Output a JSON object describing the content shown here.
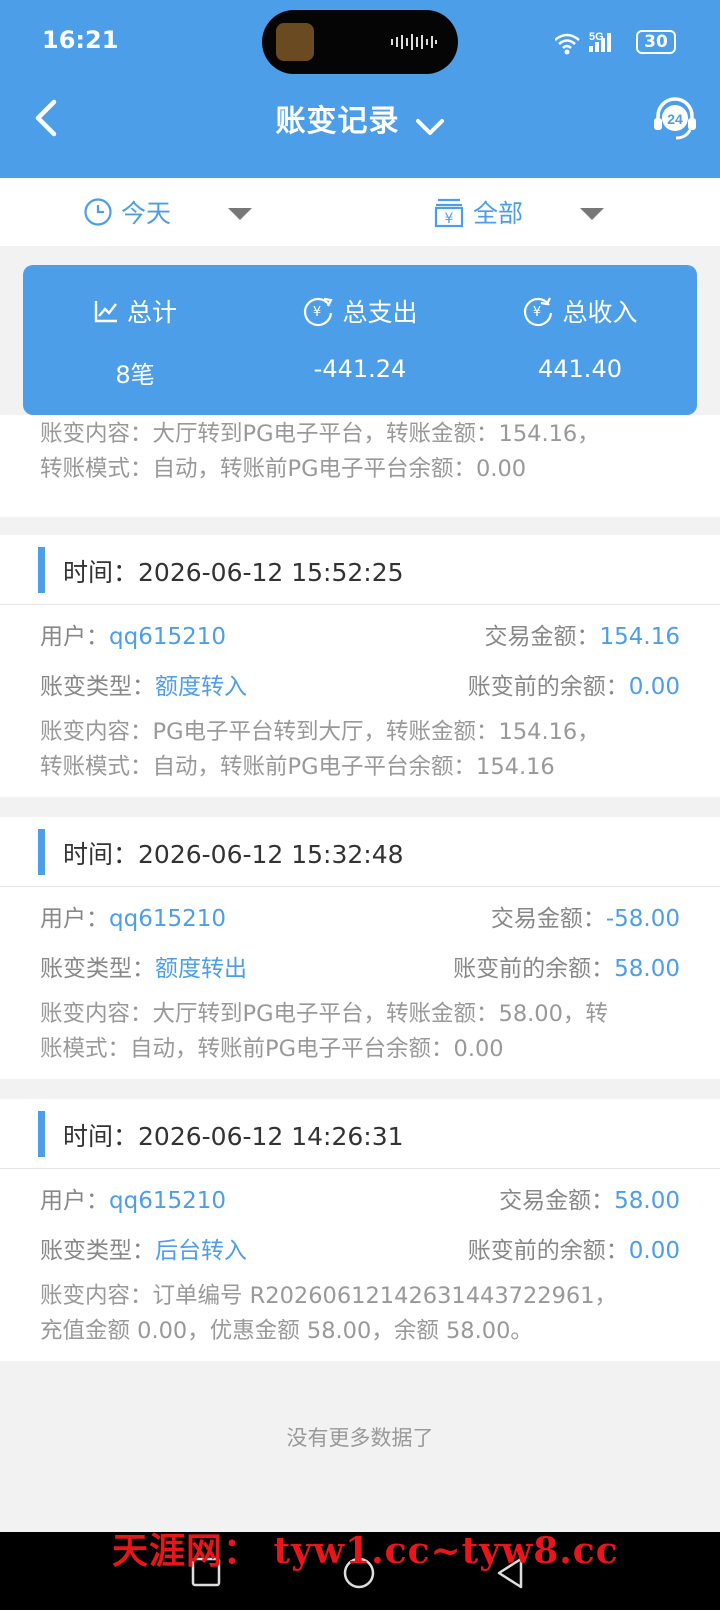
{
  "status_bar": {
    "time": "16:21",
    "network": "5G",
    "battery": "30"
  },
  "header": {
    "title": "账变记录",
    "back_icon": "chevron-left-icon",
    "support_icon": "headset-24-icon"
  },
  "filters": {
    "date": {
      "label": "今天",
      "icon": "clock-icon"
    },
    "type": {
      "label": "全部",
      "icon": "yen-box-icon"
    }
  },
  "summary": {
    "total": {
      "label": "总计",
      "value": "8笔"
    },
    "expense": {
      "label": "总支出",
      "value": "-441.24"
    },
    "income": {
      "label": "总收入",
      "value": "441.40"
    }
  },
  "records": {
    "partial": {
      "content_1": "账变内容：大厅转到PG电子平台，转账金额：154.16，",
      "content_2": "转账模式：自动，转账前PG电子平台余额：0.00"
    },
    "items": [
      {
        "time_label": "时间：",
        "time": "2026-06-12 15:52:25",
        "user_label": "用户：",
        "user": "qq615210",
        "amount_label": "交易金额：",
        "amount": "154.16",
        "type_label": "账变类型：",
        "type": "额度转入",
        "balance_label": "账变前的余额：",
        "balance": "0.00",
        "content_1": "账变内容：PG电子平台转到大厅，转账金额：154.16，",
        "content_2": "转账模式：自动，转账前PG电子平台余额：154.16"
      },
      {
        "time_label": "时间：",
        "time": "2026-06-12 15:32:48",
        "user_label": "用户：",
        "user": "qq615210",
        "amount_label": "交易金额：",
        "amount": "-58.00",
        "type_label": "账变类型：",
        "type": "额度转出",
        "balance_label": "账变前的余额：",
        "balance": "58.00",
        "content_1": "账变内容：大厅转到PG电子平台，转账金额：58.00，转",
        "content_2": "账模式：自动，转账前PG电子平台余额：0.00"
      },
      {
        "time_label": "时间：",
        "time": "2026-06-12 14:26:31",
        "user_label": "用户：",
        "user": "qq615210",
        "amount_label": "交易金额：",
        "amount": "58.00",
        "type_label": "账变类型：",
        "type": "后台转入",
        "balance_label": "账变前的余额：",
        "balance": "0.00",
        "content_1": "账变内容：订单编号 R20260612142631443722961，",
        "content_2": "充值金额 0.00，优惠金额 58.00，余额 58.00。"
      }
    ]
  },
  "no_more_text": "没有更多数据了",
  "watermark": "天涯网： tyw1.cc~tyw8.cc",
  "colors": {
    "accent": "#4d9ee9",
    "card_bg": "#ffffff",
    "page_bg": "#f2f2f2",
    "watermark": "#e8151b"
  }
}
